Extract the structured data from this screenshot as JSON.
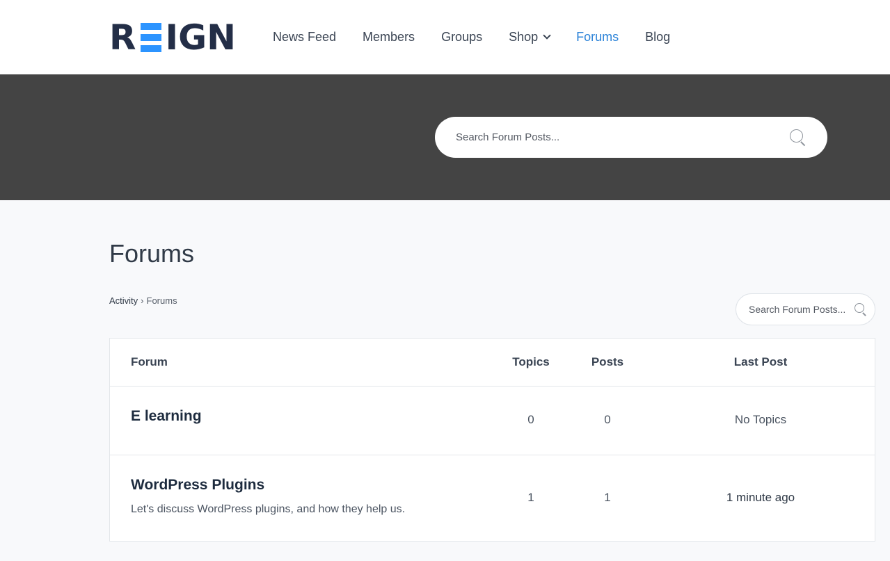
{
  "logo": {
    "left": "R",
    "right": "IGN"
  },
  "nav": {
    "items": [
      {
        "label": "News Feed"
      },
      {
        "label": "Members"
      },
      {
        "label": "Groups"
      },
      {
        "label": "Shop"
      },
      {
        "label": "Forums",
        "active": true
      },
      {
        "label": "Blog"
      }
    ]
  },
  "hero": {
    "search_placeholder": "Search Forum Posts..."
  },
  "page": {
    "title": "Forums",
    "breadcrumb": {
      "home": "Activity",
      "separator": "›",
      "current": "Forums"
    },
    "search_placeholder": "Search Forum Posts..."
  },
  "table": {
    "headers": {
      "forum": "Forum",
      "topics": "Topics",
      "posts": "Posts",
      "last_post": "Last Post"
    },
    "rows": [
      {
        "name": "E learning",
        "description": "",
        "topics": "0",
        "posts": "0",
        "last_post": "No Topics"
      },
      {
        "name": "WordPress Plugins",
        "description": "Let's discuss WordPress plugins, and how they help us.",
        "topics": "1",
        "posts": "1",
        "last_post": "1 minute ago"
      }
    ]
  },
  "colors": {
    "accent": "#2c94ff",
    "nav_active": "#2c83d8",
    "hero_bg": "#444444",
    "logo_dark": "#232e47"
  }
}
